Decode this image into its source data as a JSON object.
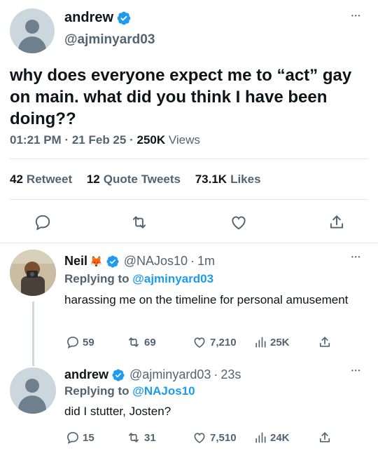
{
  "main_tweet": {
    "name": "andrew",
    "handle": "@ajminyard03",
    "text": "why does everyone expect me to “act” gay on main. what did you think I have been doing??",
    "time": "01:21 PM",
    "date": "21 Feb 25",
    "views_count": "250K",
    "views_label": "Views",
    "retweets_count": "42",
    "retweets_label": "Retweet",
    "quotes_count": "12",
    "quotes_label": "Quote Tweets",
    "likes_count": "73.1K",
    "likes_label": "Likes",
    "more": "•••"
  },
  "replies": [
    {
      "name": "Neil",
      "emoji": "🦊",
      "handle": "@NAJos10",
      "time": "1m",
      "replying_label": "Replying to",
      "replying_to": "@ajminyard03",
      "text": "harassing me on the timeline for personal amusement",
      "replies": "59",
      "retweets": "69",
      "likes": "7,210",
      "views": "25K"
    },
    {
      "name": "andrew",
      "handle": "@ajminyard03",
      "time": "23s",
      "replying_label": "Replying to",
      "replying_to": "@NAJos10",
      "text": "did I stutter, Josten?",
      "replies": "15",
      "retweets": "31",
      "likes": "7,510",
      "views": "24K"
    }
  ],
  "separators": {
    "dot": "·"
  },
  "colors": {
    "accent": "#1d9bf0",
    "text": "#0f1419",
    "secondary": "#536471",
    "divider": "#e1e8ed"
  },
  "icons": {
    "verified": "verified-badge-icon",
    "reply": "reply-icon",
    "retweet": "retweet-icon",
    "like": "heart-icon",
    "share": "share-icon",
    "views": "views-icon",
    "more": "more-icon"
  }
}
